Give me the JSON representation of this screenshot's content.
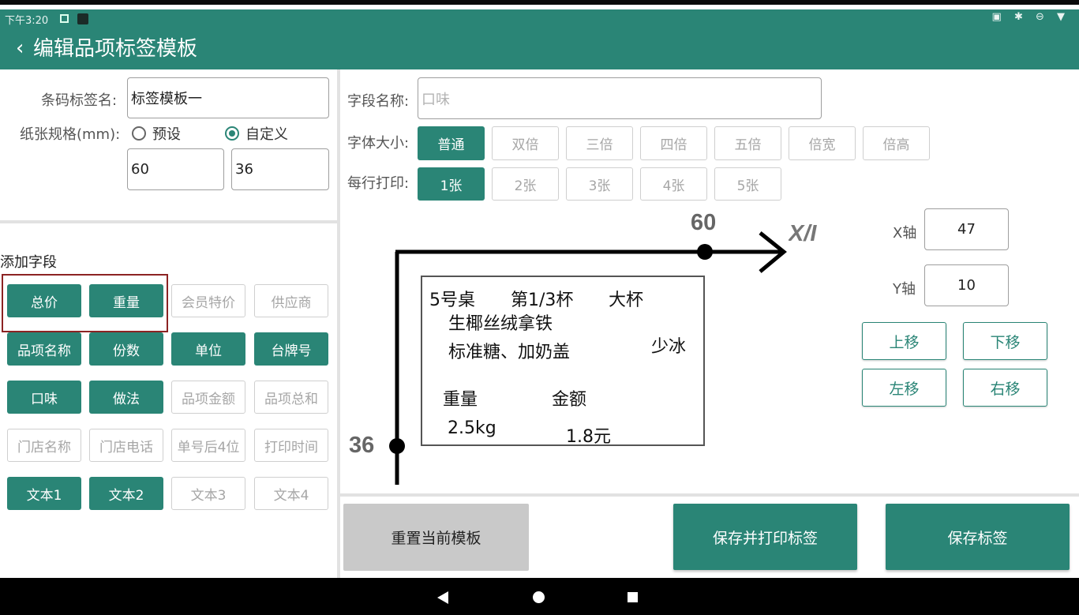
{
  "status": {
    "time": "下午3:20",
    "right_icons": "▣ ✱ ⊖ ▼"
  },
  "header": {
    "back_icon": "‹",
    "title": "编辑品项标签模板"
  },
  "left": {
    "name_label": "条码标签名:",
    "name_value": "标签模板一",
    "paper_label": "纸张规格(mm):",
    "radio_preset": "预设",
    "radio_custom": "自定义",
    "selected_radio": "custom",
    "width_value": "60",
    "height_value": "36",
    "add_field_title": "添加字段",
    "fields": [
      {
        "label": "总价",
        "active": true
      },
      {
        "label": "重量",
        "active": true
      },
      {
        "label": "会员特价",
        "active": false
      },
      {
        "label": "供应商",
        "active": false
      },
      {
        "label": "品项名称",
        "active": true
      },
      {
        "label": "份数",
        "active": true
      },
      {
        "label": "单位",
        "active": true
      },
      {
        "label": "台牌号",
        "active": true
      },
      {
        "label": "口味",
        "active": true
      },
      {
        "label": "做法",
        "active": true
      },
      {
        "label": "品项金额",
        "active": false
      },
      {
        "label": "品项总和",
        "active": false
      },
      {
        "label": "门店名称",
        "active": false
      },
      {
        "label": "门店电话",
        "active": false
      },
      {
        "label": "单号后4位",
        "active": false
      },
      {
        "label": "打印时间",
        "active": false
      },
      {
        "label": "文本1",
        "active": true
      },
      {
        "label": "文本2",
        "active": true
      },
      {
        "label": "文本3",
        "active": false
      },
      {
        "label": "文本4",
        "active": false
      }
    ]
  },
  "right": {
    "field_name_label": "字段名称:",
    "field_name_placeholder": "口味",
    "font_size_label": "字体大小:",
    "font_sizes": [
      {
        "label": "普通",
        "active": true
      },
      {
        "label": "双倍",
        "active": false
      },
      {
        "label": "三倍",
        "active": false
      },
      {
        "label": "四倍",
        "active": false
      },
      {
        "label": "五倍",
        "active": false
      },
      {
        "label": "倍宽",
        "active": false
      },
      {
        "label": "倍高",
        "active": false
      }
    ],
    "per_row_label": "每行打印:",
    "per_row": [
      {
        "label": "1张",
        "active": true
      },
      {
        "label": "2张",
        "active": false
      },
      {
        "label": "3张",
        "active": false
      },
      {
        "label": "4张",
        "active": false
      },
      {
        "label": "5张",
        "active": false
      }
    ],
    "x_axis_label": "X轴",
    "x_value": "47",
    "y_axis_label": "Y轴",
    "y_value": "10",
    "move_up": "上移",
    "move_down": "下移",
    "move_left": "左移",
    "move_right": "右移"
  },
  "preview": {
    "width_num": "60",
    "height_num": "36",
    "axis_tag": "X/I",
    "table": "5号桌",
    "cup": "第1/3杯",
    "size": "大杯",
    "item": "生椰丝绒拿铁",
    "options": "标准糖、加奶盖",
    "ice": "少冰",
    "weight_label": "重量",
    "amount_label": "金额",
    "weight_value": "2.5kg",
    "amount_value": "1.8元"
  },
  "footer": {
    "reset": "重置当前模板",
    "save_print": "保存并打印标签",
    "save": "保存标签"
  },
  "colors": {
    "primary": "#2a8576",
    "highlight": "#8c2323"
  }
}
